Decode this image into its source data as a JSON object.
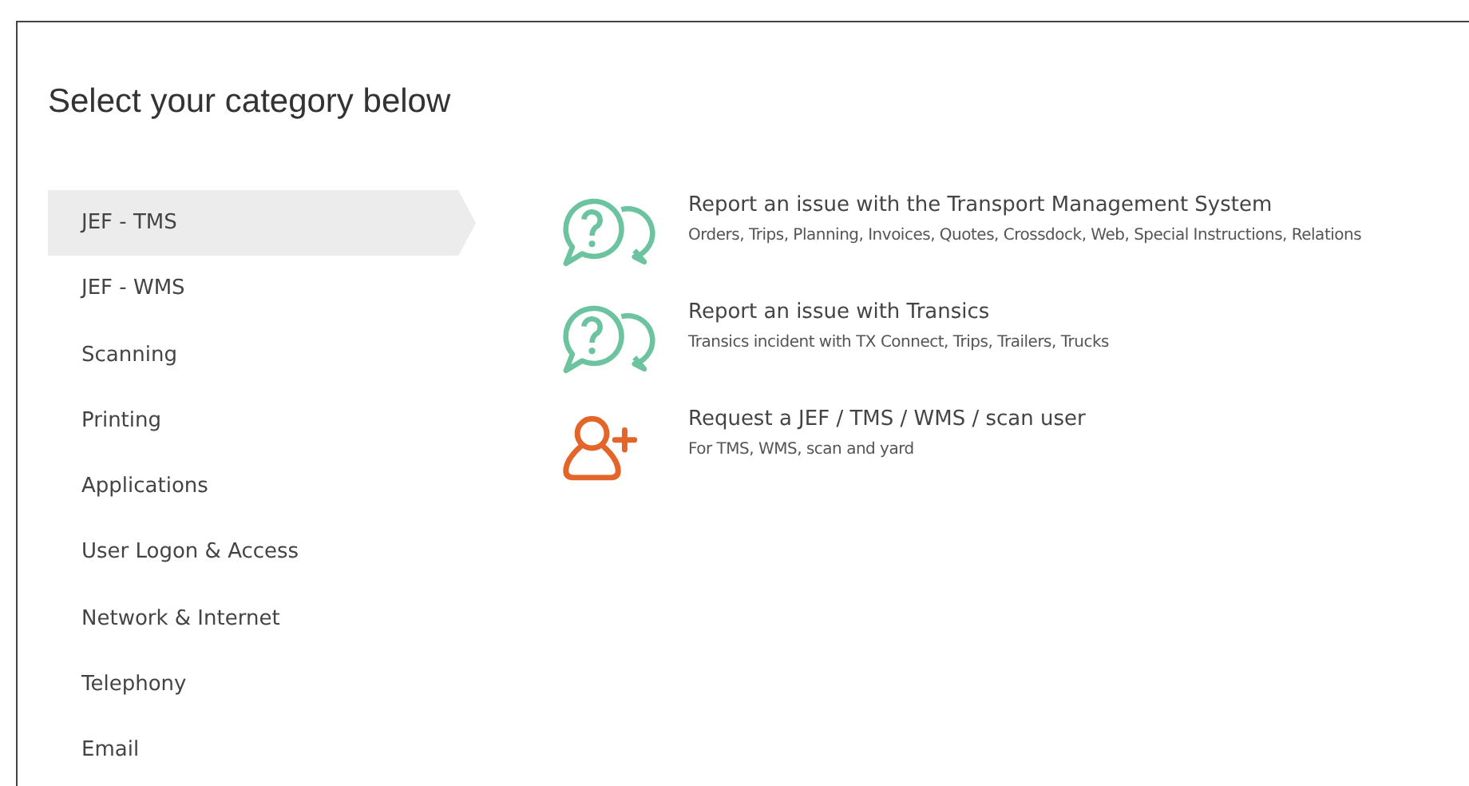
{
  "title": "Select your category below",
  "categories": [
    {
      "label": "JEF - TMS",
      "selected": true
    },
    {
      "label": "JEF - WMS",
      "selected": false
    },
    {
      "label": "Scanning",
      "selected": false
    },
    {
      "label": "Printing",
      "selected": false
    },
    {
      "label": "Applications",
      "selected": false
    },
    {
      "label": "User Logon & Access",
      "selected": false
    },
    {
      "label": "Network & Internet",
      "selected": false
    },
    {
      "label": "Telephony",
      "selected": false
    },
    {
      "label": "Email",
      "selected": false
    }
  ],
  "options": [
    {
      "kind": "chat",
      "title": "Report an issue with the Transport Management System",
      "description": "Orders, Trips, Planning, Invoices, Quotes, Crossdock, Web, Special Instructions, Relations"
    },
    {
      "kind": "chat",
      "title": "Report an issue with Transics",
      "description": "Transics incident with TX Connect, Trips, Trailers, Trucks"
    },
    {
      "kind": "user",
      "title": "Request a JEF / TMS / WMS / scan user",
      "description": "For TMS, WMS, scan and yard"
    }
  ]
}
